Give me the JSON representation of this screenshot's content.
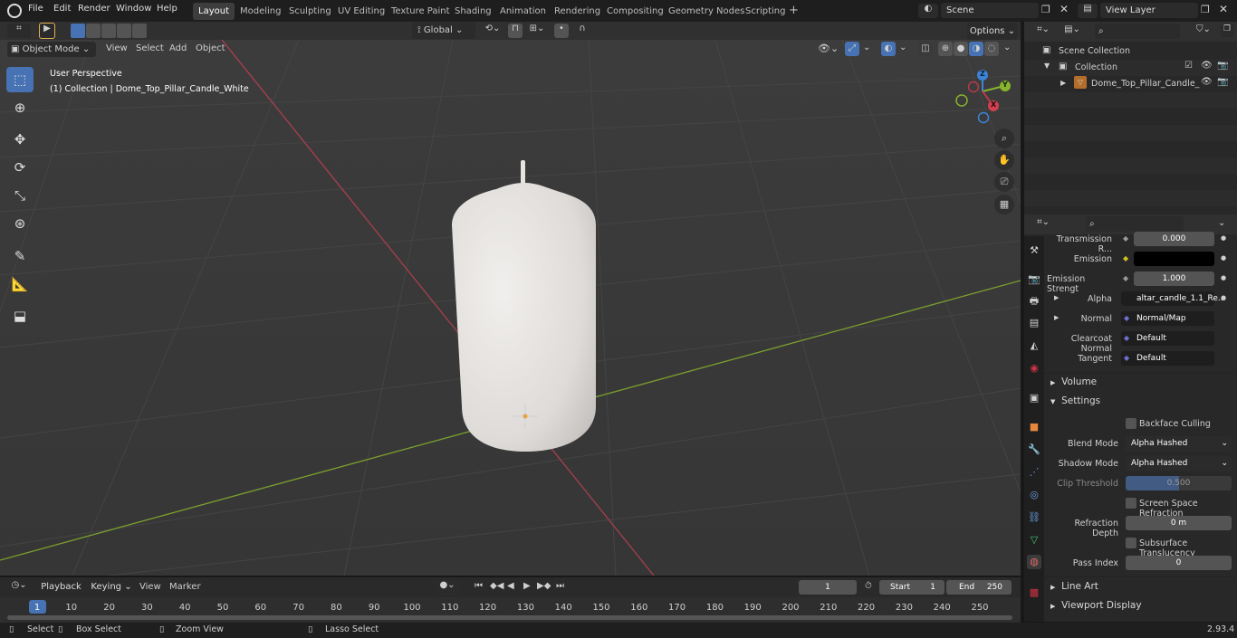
{
  "app": {
    "version": "2.93.4"
  },
  "menus": [
    "File",
    "Edit",
    "Render",
    "Window",
    "Help"
  ],
  "workspaces": [
    "Layout",
    "Modeling",
    "Sculpting",
    "UV Editing",
    "Texture Paint",
    "Shading",
    "Animation",
    "Rendering",
    "Compositing",
    "Geometry Nodes",
    "Scripting"
  ],
  "active_workspace": "Layout",
  "scene": {
    "name": "Scene",
    "view_layer": "View Layer"
  },
  "viewport_header": {
    "mode": "Object Mode",
    "menu": [
      "View",
      "Select",
      "Add",
      "Object"
    ],
    "transform_orientation": "Global",
    "options": "Options"
  },
  "viewport": {
    "perspective": "User Perspective",
    "collection_info": "(1) Collection | Dome_Top_Pillar_Candle_White",
    "gizmo": {
      "x": "X",
      "y": "Y",
      "z": "Z"
    }
  },
  "outliner": {
    "scene_collection": "Scene Collection",
    "collection": "Collection",
    "object": "Dome_Top_Pillar_Candle_"
  },
  "properties": {
    "rows": [
      {
        "label": "Transmission R...",
        "value": "0.000"
      },
      {
        "label": "Emission",
        "value": ""
      },
      {
        "label": "Emission Strengt",
        "value": "1.000"
      },
      {
        "label": "Alpha",
        "value": "altar_candle_1.1_Re..."
      },
      {
        "label": "Normal",
        "value": "Normal/Map"
      },
      {
        "label": "Clearcoat Normal",
        "value": "Default"
      },
      {
        "label": "Tangent",
        "value": "Default"
      }
    ],
    "sections": {
      "volume": "Volume",
      "settings": "Settings",
      "line_art": "Line Art",
      "viewport_display": "Viewport Display"
    },
    "settings": {
      "backface_culling": "Backface Culling",
      "blend_mode_label": "Blend Mode",
      "blend_mode": "Alpha Hashed",
      "shadow_mode_label": "Shadow Mode",
      "shadow_mode": "Alpha Hashed",
      "clip_threshold_label": "Clip Threshold",
      "clip_threshold": "0.500",
      "ssr": "Screen Space Refraction",
      "refraction_depth_label": "Refraction Depth",
      "refraction_depth": "0 m",
      "subsurface": "Subsurface Translucency",
      "pass_index_label": "Pass Index",
      "pass_index": "0"
    }
  },
  "timeline": {
    "menus": [
      "Playback",
      "Keying",
      "View",
      "Marker"
    ],
    "current_frame": "1",
    "start_label": "Start",
    "start": "1",
    "end_label": "End",
    "end": "250",
    "ticks": [
      "1",
      "10",
      "20",
      "30",
      "40",
      "50",
      "60",
      "70",
      "80",
      "90",
      "100",
      "110",
      "120",
      "130",
      "140",
      "150",
      "160",
      "170",
      "180",
      "190",
      "200",
      "210",
      "220",
      "230",
      "240",
      "250"
    ]
  },
  "statusbar": {
    "select": "Select",
    "box_select": "Box Select",
    "zoom_view": "Zoom View",
    "lasso_select": "Lasso Select"
  },
  "colors": {
    "accent": "#4772b3",
    "x_axis": "#b53a48",
    "y_axis": "#86b42e",
    "z_axis": "#3c84d6",
    "viewport_bg": "#3a3a3a"
  }
}
